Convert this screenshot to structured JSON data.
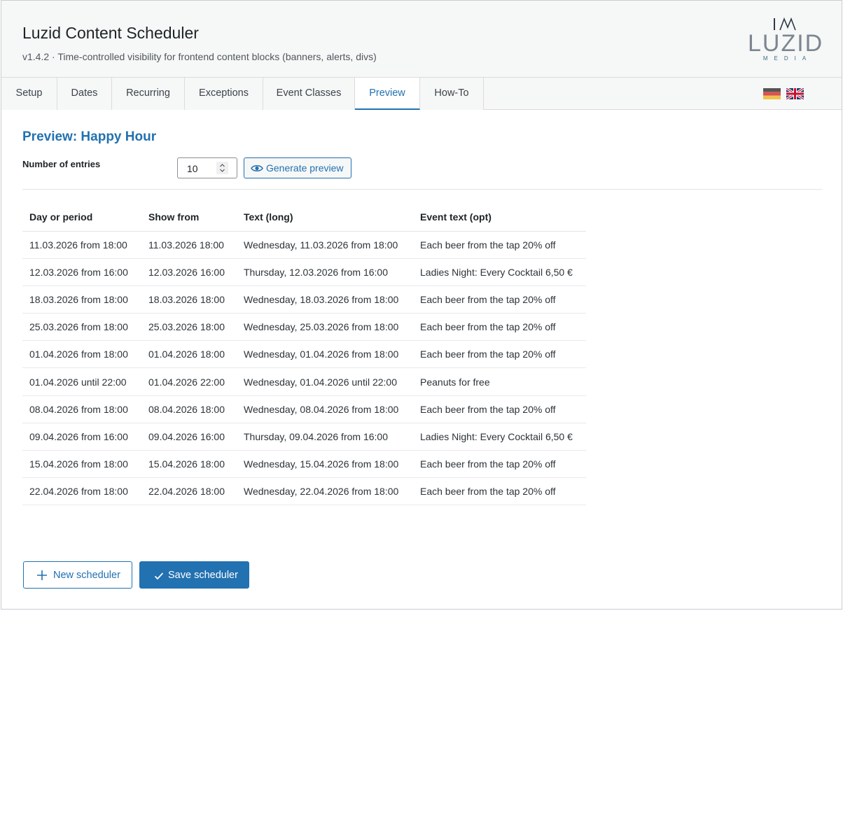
{
  "header": {
    "title": "Luzid Content Scheduler",
    "subtitle": "v1.4.2 · Time-controlled visibility for frontend content blocks (banners, alerts, divs)",
    "logo": {
      "word": "LUZID",
      "small": "MEDIA",
      "color": "#7b8691"
    }
  },
  "tabs": [
    {
      "label": "Setup"
    },
    {
      "label": "Dates"
    },
    {
      "label": "Recurring"
    },
    {
      "label": "Exceptions"
    },
    {
      "label": "Event Classes"
    },
    {
      "label": "Preview",
      "active": true
    },
    {
      "label": "How-To"
    }
  ],
  "languages": [
    "flag-de-icon",
    "flag-uk-icon"
  ],
  "preview": {
    "title": "Preview: Happy Hour",
    "entries_label": "Number of entries",
    "entries_value": "10",
    "generate_label": "Generate preview"
  },
  "table": {
    "headers": [
      "Day or period",
      "Show from",
      "Text (long)",
      "Event text (opt)"
    ],
    "rows": [
      [
        "11.03.2026 from 18:00",
        "11.03.2026 18:00",
        "Wednesday, 11.03.2026 from 18:00",
        "Each beer from the tap 20% off"
      ],
      [
        "12.03.2026 from 16:00",
        "12.03.2026 16:00",
        "Thursday, 12.03.2026 from 16:00",
        "Ladies Night: Every Cocktail 6,50 €"
      ],
      [
        "18.03.2026 from 18:00",
        "18.03.2026 18:00",
        "Wednesday, 18.03.2026 from 18:00",
        "Each beer from the tap 20% off"
      ],
      [
        "25.03.2026 from 18:00",
        "25.03.2026 18:00",
        "Wednesday, 25.03.2026 from 18:00",
        "Each beer from the tap 20% off"
      ],
      [
        "01.04.2026 from 18:00",
        "01.04.2026 18:00",
        "Wednesday, 01.04.2026 from 18:00",
        "Each beer from the tap 20% off"
      ],
      [
        "01.04.2026 until 22:00",
        "01.04.2026 22:00",
        "Wednesday, 01.04.2026 until 22:00",
        "Peanuts for free"
      ],
      [
        "08.04.2026 from 18:00",
        "08.04.2026 18:00",
        "Wednesday, 08.04.2026 from 18:00",
        "Each beer from the tap 20% off"
      ],
      [
        "09.04.2026 from 16:00",
        "09.04.2026 16:00",
        "Thursday, 09.04.2026 from 16:00",
        "Ladies Night: Every Cocktail 6,50 €"
      ],
      [
        "15.04.2026 from 18:00",
        "15.04.2026 18:00",
        "Wednesday, 15.04.2026 from 18:00",
        "Each beer from the tap 20% off"
      ],
      [
        "22.04.2026 from 18:00",
        "22.04.2026 18:00",
        "Wednesday, 22.04.2026 from 18:00",
        "Each beer from the tap 20% off"
      ]
    ]
  },
  "actions": {
    "new_label": "New scheduler",
    "save_label": "Save scheduler"
  },
  "colors": {
    "accent": "#2271b1",
    "header_bg": "#f6f7f7",
    "border": "#dcdcde"
  }
}
